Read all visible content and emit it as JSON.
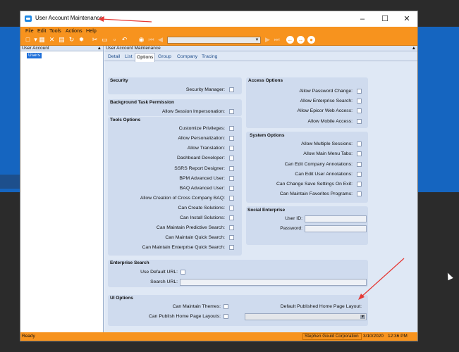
{
  "window": {
    "title": "User Account Maintenance"
  },
  "menu": [
    "File",
    "Edit",
    "Tools",
    "Actions",
    "Help"
  ],
  "left_panel": {
    "header": "User Account",
    "tree_item": "Users"
  },
  "main": {
    "header": "User Account Maintenance",
    "tabs": [
      "Detail",
      "List",
      "Options",
      "Group",
      "Company",
      "Tracing"
    ],
    "active_tab": "Options"
  },
  "security": {
    "title": "Security",
    "items": [
      "Security Manager:"
    ]
  },
  "background": {
    "title": "Background Task Permission",
    "items": [
      "Allow Session Impersonation:"
    ]
  },
  "tools": {
    "title": "Tools Options",
    "items": [
      "Customize Privileges:",
      "Allow Personalization:",
      "Allow Translation:",
      "Dashboard Developer:",
      "SSRS Report Designer:",
      "BPM Advanced User:",
      "BAQ Advanced User:",
      "Allow Creation of Cross Company BAQ:",
      "Can Create Solutions:",
      "Can Install Solutions:",
      "Can Maintain Predictive Search:",
      "Can Maintain Quick Search:",
      "Can Maintain Enterprise Quick Search:"
    ]
  },
  "access": {
    "title": "Access Options",
    "items": [
      "Allow Password Change:",
      "Allow Enterprise Search:",
      "Allow Epicor Web Access:",
      "Allow Mobile Access:"
    ]
  },
  "system": {
    "title": "System Options",
    "items": [
      "Allow Multiple Sessions:",
      "Allow Main Menu Tabs:",
      "Can Edit Company Annotations:",
      "Can Edit User Annotations:",
      "Can Change Save Settings On Exit:",
      "Can Maintain Favorites Programs:"
    ]
  },
  "social": {
    "title": "Social Enterprise",
    "user_id_label": "User ID:",
    "password_label": "Password:"
  },
  "enterprise_search": {
    "title": "Enterprise Search",
    "default_url_label": "Use Default URL:",
    "search_url_label": "Search URL:"
  },
  "ui_options": {
    "title": "UI Options",
    "maintain_themes_label": "Can Maintain Themes:",
    "publish_layouts_label": "Can Publish Home Page Layouts:",
    "default_layout_label": "Default Published Home Page Layout:"
  },
  "status": {
    "ready": "Ready",
    "company": "Stephen Gould Corporation",
    "date": "3/10/2020",
    "time": "12:36 PM"
  },
  "colors": {
    "accent": "#f7931e",
    "panel": "#dfe8f5",
    "group": "#cfdbee",
    "annotation_arrow": "#e53935"
  }
}
